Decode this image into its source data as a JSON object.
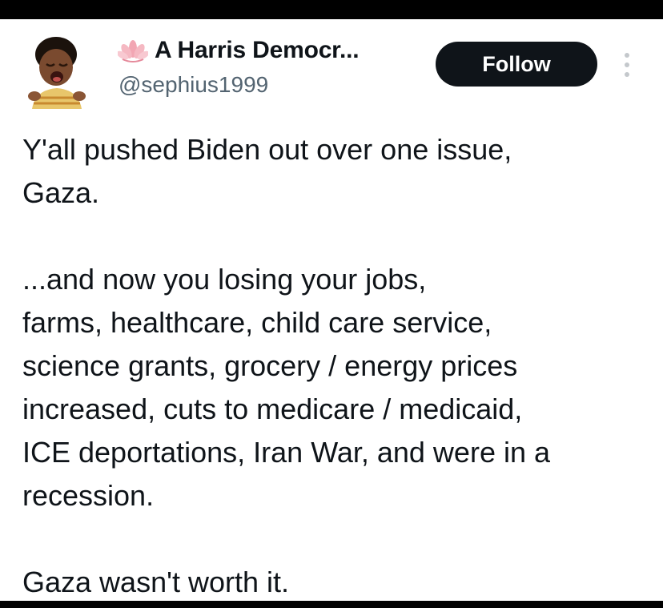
{
  "author": {
    "display_name": "A Harris Democr...",
    "handle": "@sephius1999",
    "avatar_icon": "crying-child-avatar",
    "name_emoji_icon": "lotus-icon"
  },
  "actions": {
    "follow_label": "Follow",
    "more_icon": "vertical-ellipsis-icon"
  },
  "tweet": {
    "paragraph_1": "Y'all pushed Biden out over one issue,\nGaza.",
    "paragraph_2": "...and now you losing your jobs,\nfarms, healthcare, child care service,\nscience grants, grocery / energy prices\nincreased, cuts to medicare / medicaid,\nICE deportations, Iran War, and were in a\nrecession.",
    "paragraph_3": "Gaza wasn't worth it."
  },
  "colors": {
    "text_primary": "#0f1419",
    "text_secondary": "#536471",
    "button_bg": "#0f1419",
    "button_text": "#ffffff",
    "frame": "#000000"
  }
}
